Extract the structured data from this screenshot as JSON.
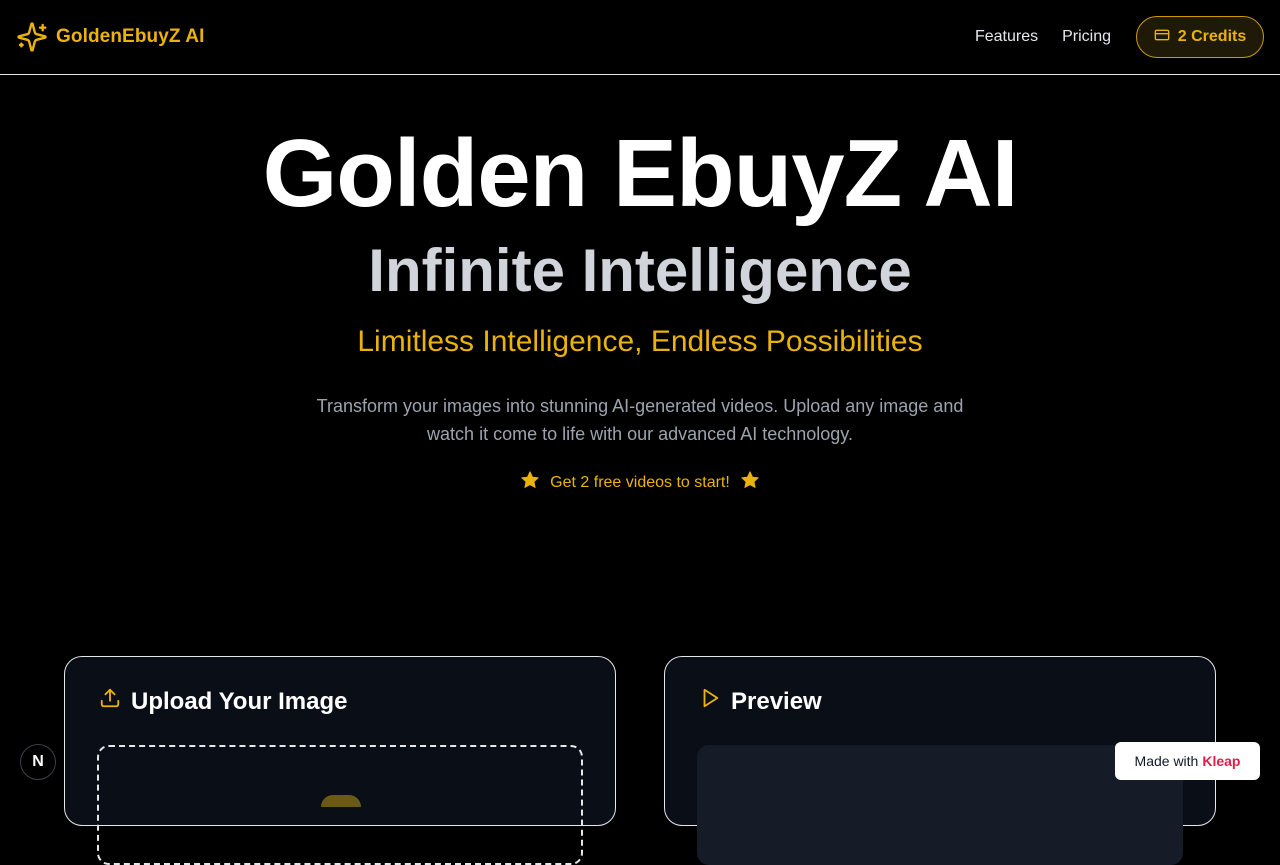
{
  "header": {
    "brand": "GoldenEbuyZ AI",
    "nav": [
      "Features",
      "Pricing"
    ],
    "credits_label": "2 Credits"
  },
  "hero": {
    "title": "Golden EbuyZ AI",
    "subtitle": "Infinite Intelligence",
    "tagline": "Limitless Intelligence, Endless Possibilities",
    "description_line1": "Transform your images into stunning AI-generated videos. Upload any image and",
    "description_line2": "watch it come to life with our advanced AI technology.",
    "promo": "Get 2 free videos to start!"
  },
  "upload_card": {
    "title": "Upload Your Image"
  },
  "preview_card": {
    "title": "Preview"
  },
  "floating": {
    "next_badge": "N",
    "made_with_prefix": "Made with",
    "made_with_brand": "Kleap"
  },
  "colors": {
    "accent": "#eab308",
    "background": "#000000",
    "card_background": "#0a0e17",
    "kleap": "#e11d48"
  },
  "icons": {
    "brand": "sparkles-icon",
    "credits": "credit-card-icon",
    "promo": "star-icon",
    "upload": "upload-icon",
    "preview": "play-icon"
  }
}
